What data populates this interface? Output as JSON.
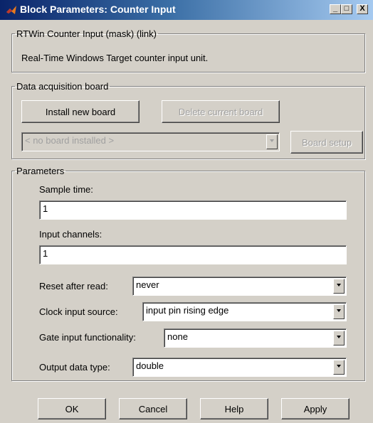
{
  "window": {
    "title": "Block Parameters: Counter Input",
    "minimize_glyph": "_",
    "maximize_glyph": "□",
    "close_glyph": "X"
  },
  "mask": {
    "legend": "RTWin Counter Input (mask) (link)",
    "description": "Real-Time Windows Target counter input unit."
  },
  "daq": {
    "legend": "Data acquisition board",
    "install_label": "Install new board",
    "delete_label": "Delete current board",
    "board_select_value": "< no board installed >",
    "board_setup_label": "Board setup"
  },
  "params": {
    "legend": "Parameters",
    "sample_time_label": "Sample time:",
    "sample_time_value": "1",
    "input_channels_label": "Input channels:",
    "input_channels_value": "1",
    "reset_label": "Reset after read:",
    "reset_value": "never",
    "clock_label": "Clock input source:",
    "clock_value": "input pin rising edge",
    "gate_label": "Gate input functionality:",
    "gate_value": "none",
    "output_label": "Output data type:",
    "output_value": "double"
  },
  "footer": {
    "ok_label": "OK",
    "cancel_label": "Cancel",
    "help_label": "Help",
    "apply_label": "Apply"
  },
  "colors": {
    "title_gradient_start": "#0a246a",
    "title_gradient_end": "#a6caf0",
    "dialog_face": "#d4d0c8"
  }
}
